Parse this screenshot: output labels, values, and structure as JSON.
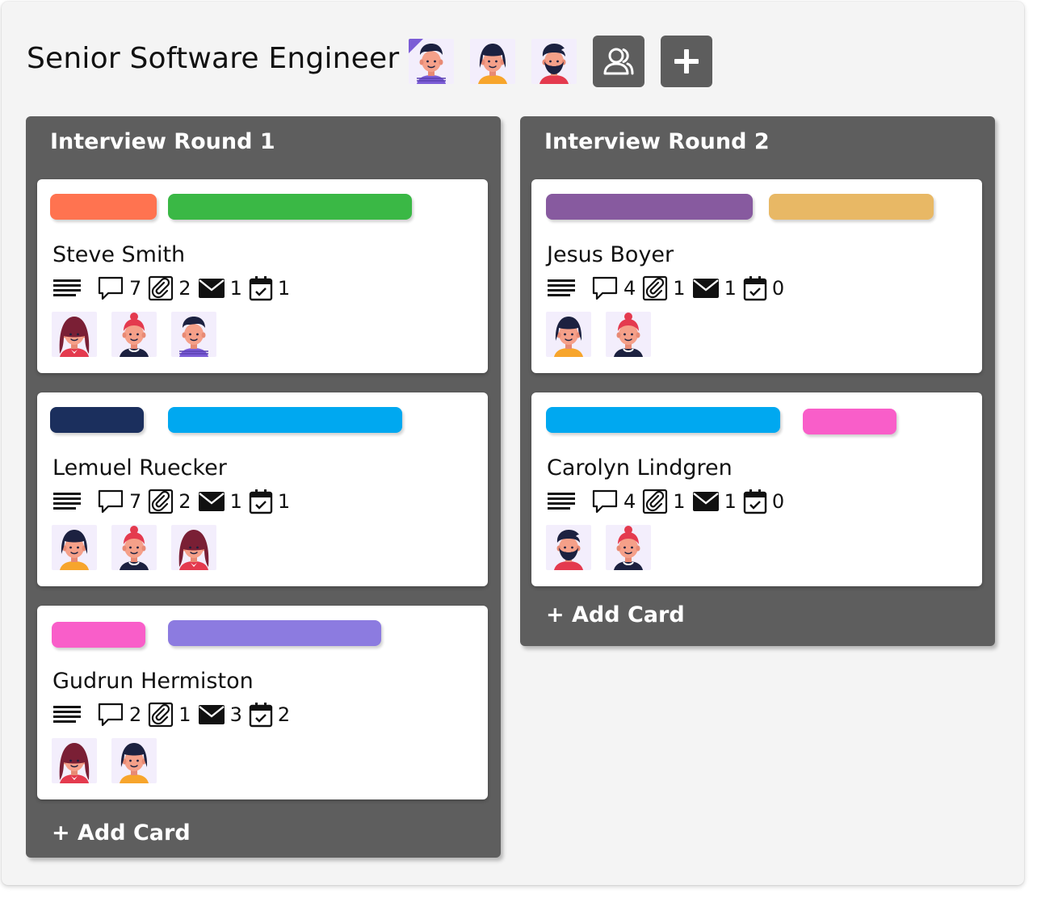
{
  "board": {
    "title": "Senior Software Engineer",
    "members": [
      "man-blue",
      "woman-orange",
      "man-beard-red"
    ],
    "share_icon": "users-icon",
    "add_icon": "plus-icon"
  },
  "colors": {
    "frame_bg": "#f4f4f4",
    "column_bg": "#5e5e5e",
    "button_bg": "#5d5d5d",
    "avatar_bg": "#f3eefc"
  },
  "columns": [
    {
      "title": "Interview Round 1",
      "add_label": "+ Add  Card",
      "cards": [
        {
          "name": "Steve Smith",
          "labels": [
            "#ff7350",
            "#3ab845"
          ],
          "comments": "7",
          "attachments": "2",
          "emails": "1",
          "tasks": "1",
          "members": [
            "woman-red",
            "woman-bun",
            "man-blue"
          ]
        },
        {
          "name": "Lemuel Ruecker",
          "labels": [
            "#1b2f5d",
            "#00a8f0"
          ],
          "comments": "7",
          "attachments": "2",
          "emails": "1",
          "tasks": "1",
          "members": [
            "woman-orange",
            "woman-bun",
            "woman-red"
          ]
        },
        {
          "name": "Gudrun Hermiston",
          "labels": [
            "#f95ec9",
            "#8c7be0"
          ],
          "comments": "2",
          "attachments": "1",
          "emails": "3",
          "tasks": "2",
          "members": [
            "woman-red",
            "woman-orange"
          ]
        }
      ]
    },
    {
      "title": "Interview Round 2",
      "add_label": "+ Add  Card",
      "cards": [
        {
          "name": "Jesus Boyer",
          "labels": [
            "#875a9f",
            "#e8b865"
          ],
          "comments": "4",
          "attachments": "1",
          "emails": "1",
          "tasks": "0",
          "members": [
            "woman-orange",
            "woman-bun"
          ]
        },
        {
          "name": "Carolyn Lindgren",
          "labels": [
            "#00a8f0",
            "#f95ec9"
          ],
          "comments": "4",
          "attachments": "1",
          "emails": "1",
          "tasks": "0",
          "members": [
            "man-beard-red",
            "woman-bun"
          ]
        }
      ]
    }
  ]
}
